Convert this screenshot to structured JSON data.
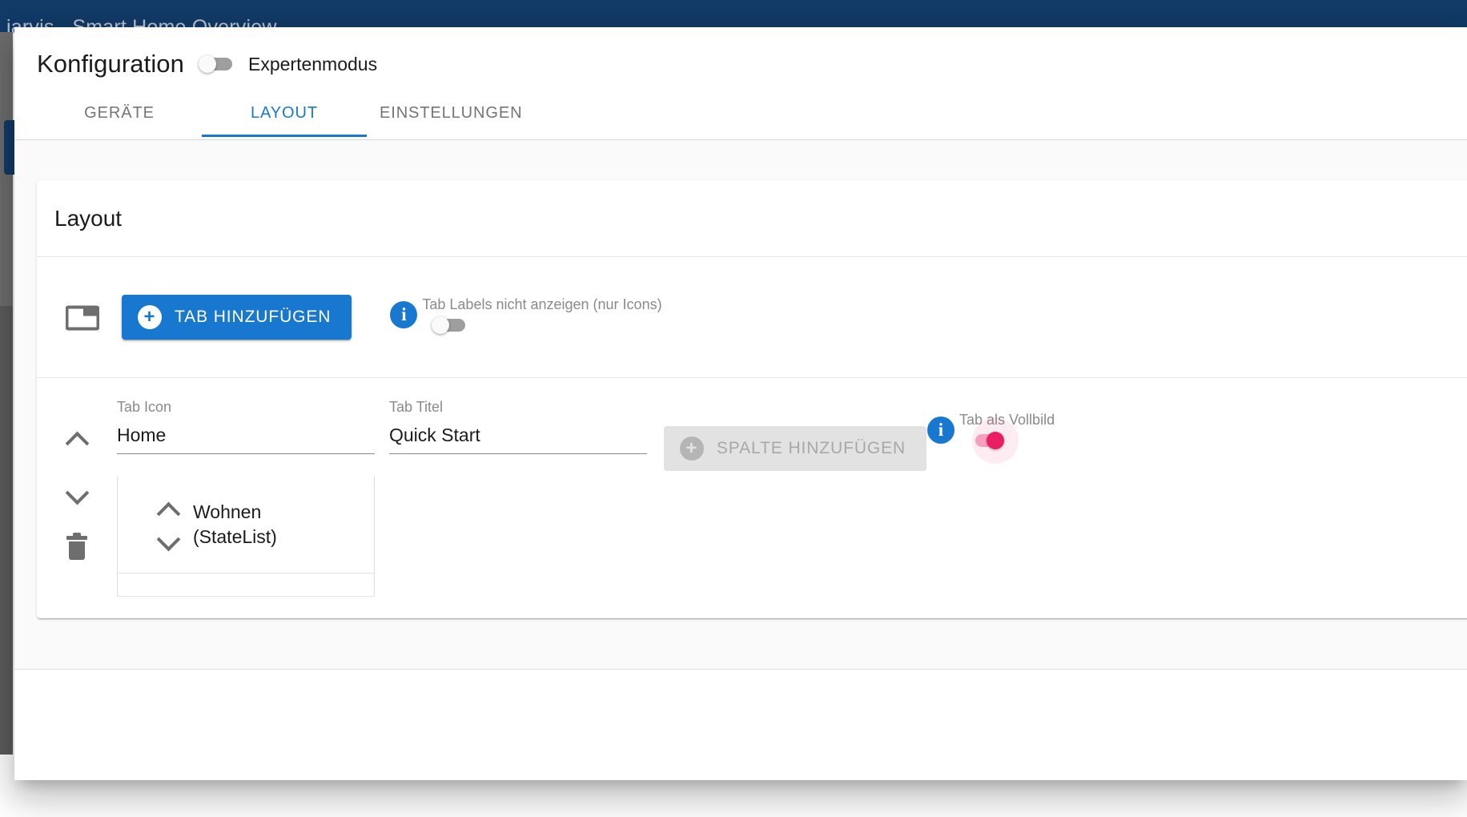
{
  "background": {
    "app_title": "jarvis - Smart Home Overview",
    "topbar_color": "#123b68",
    "sidebar_color": "#6d6d6d"
  },
  "dialog": {
    "title": "Konfiguration",
    "expert_mode": {
      "label": "Expertenmodus",
      "state": "off"
    },
    "tabs": [
      {
        "label": "GERÄTE",
        "active": false
      },
      {
        "label": "LAYOUT",
        "active": true
      },
      {
        "label": "EINSTELLUNGEN",
        "active": false
      }
    ],
    "accent_color": "#1878d0",
    "active_toggle_color": "#e91e63"
  },
  "card": {
    "header_title": "Layout",
    "add_tab": {
      "tab_icon_name": "tab-outline-icon",
      "button_label": "TAB HINZUFÜGEN",
      "plus_icon": "plus-circle-icon",
      "info_icon": "info-icon",
      "info_caption": "Tab Labels nicht anzeigen (nur Icons)",
      "toggle_state": "off"
    },
    "tab_entry": {
      "move_up_icon": "chevron-up-icon",
      "move_down_icon": "chevron-down-icon",
      "delete_icon": "trash-icon",
      "icon_field": {
        "label": "Tab Icon",
        "value": "Home"
      },
      "title_field": {
        "label": "Tab Titel",
        "value": "Quick Start"
      },
      "add_column": {
        "label": "SPALTE HINZUFÜGEN",
        "disabled": true,
        "plus_icon": "plus-circle-icon"
      },
      "fullscreen": {
        "info_icon": "info-icon",
        "caption": "Tab als Vollbild",
        "toggle_state": "on"
      },
      "widgets": [
        {
          "name": "Wohnen",
          "type": "(StateList)",
          "move_up_icon": "chevron-up-icon",
          "move_down_icon": "chevron-down-icon"
        }
      ]
    }
  }
}
